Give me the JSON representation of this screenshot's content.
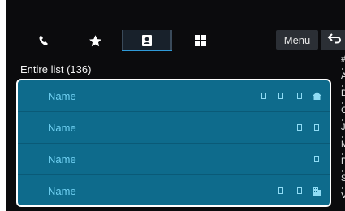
{
  "tabs": [
    {
      "name": "tab-recent-calls",
      "icon": "phone-icon",
      "active": false
    },
    {
      "name": "tab-favorites",
      "icon": "star-icon",
      "active": false
    },
    {
      "name": "tab-contacts",
      "icon": "contacts-icon",
      "active": true
    },
    {
      "name": "tab-keypad",
      "icon": "keypad-icon",
      "active": false
    }
  ],
  "header": {
    "menu_label": "Menu",
    "back_icon": "back-arrow-icon"
  },
  "list": {
    "count_label": "Entire list (136)",
    "items": [
      {
        "name": "Name",
        "icons": [
          "number-type-icon",
          "number-type-icon",
          "number-type-icon",
          "home-icon"
        ]
      },
      {
        "name": "Name",
        "icons": [
          "number-type-icon",
          "number-type-icon"
        ]
      },
      {
        "name": "Name",
        "icons": [
          "number-type-icon"
        ]
      },
      {
        "name": "Name",
        "icons": [
          "number-type-icon",
          "number-type-icon",
          "office-icon"
        ]
      }
    ]
  },
  "alpha_index": [
    "#",
    "A",
    "D",
    "G",
    "J",
    "M",
    "P",
    "S",
    "V"
  ],
  "colors": {
    "list_bg": "#0e6b8c",
    "name_text": "#6fd0f2",
    "active_tab_underline": "#2f9ad8"
  }
}
